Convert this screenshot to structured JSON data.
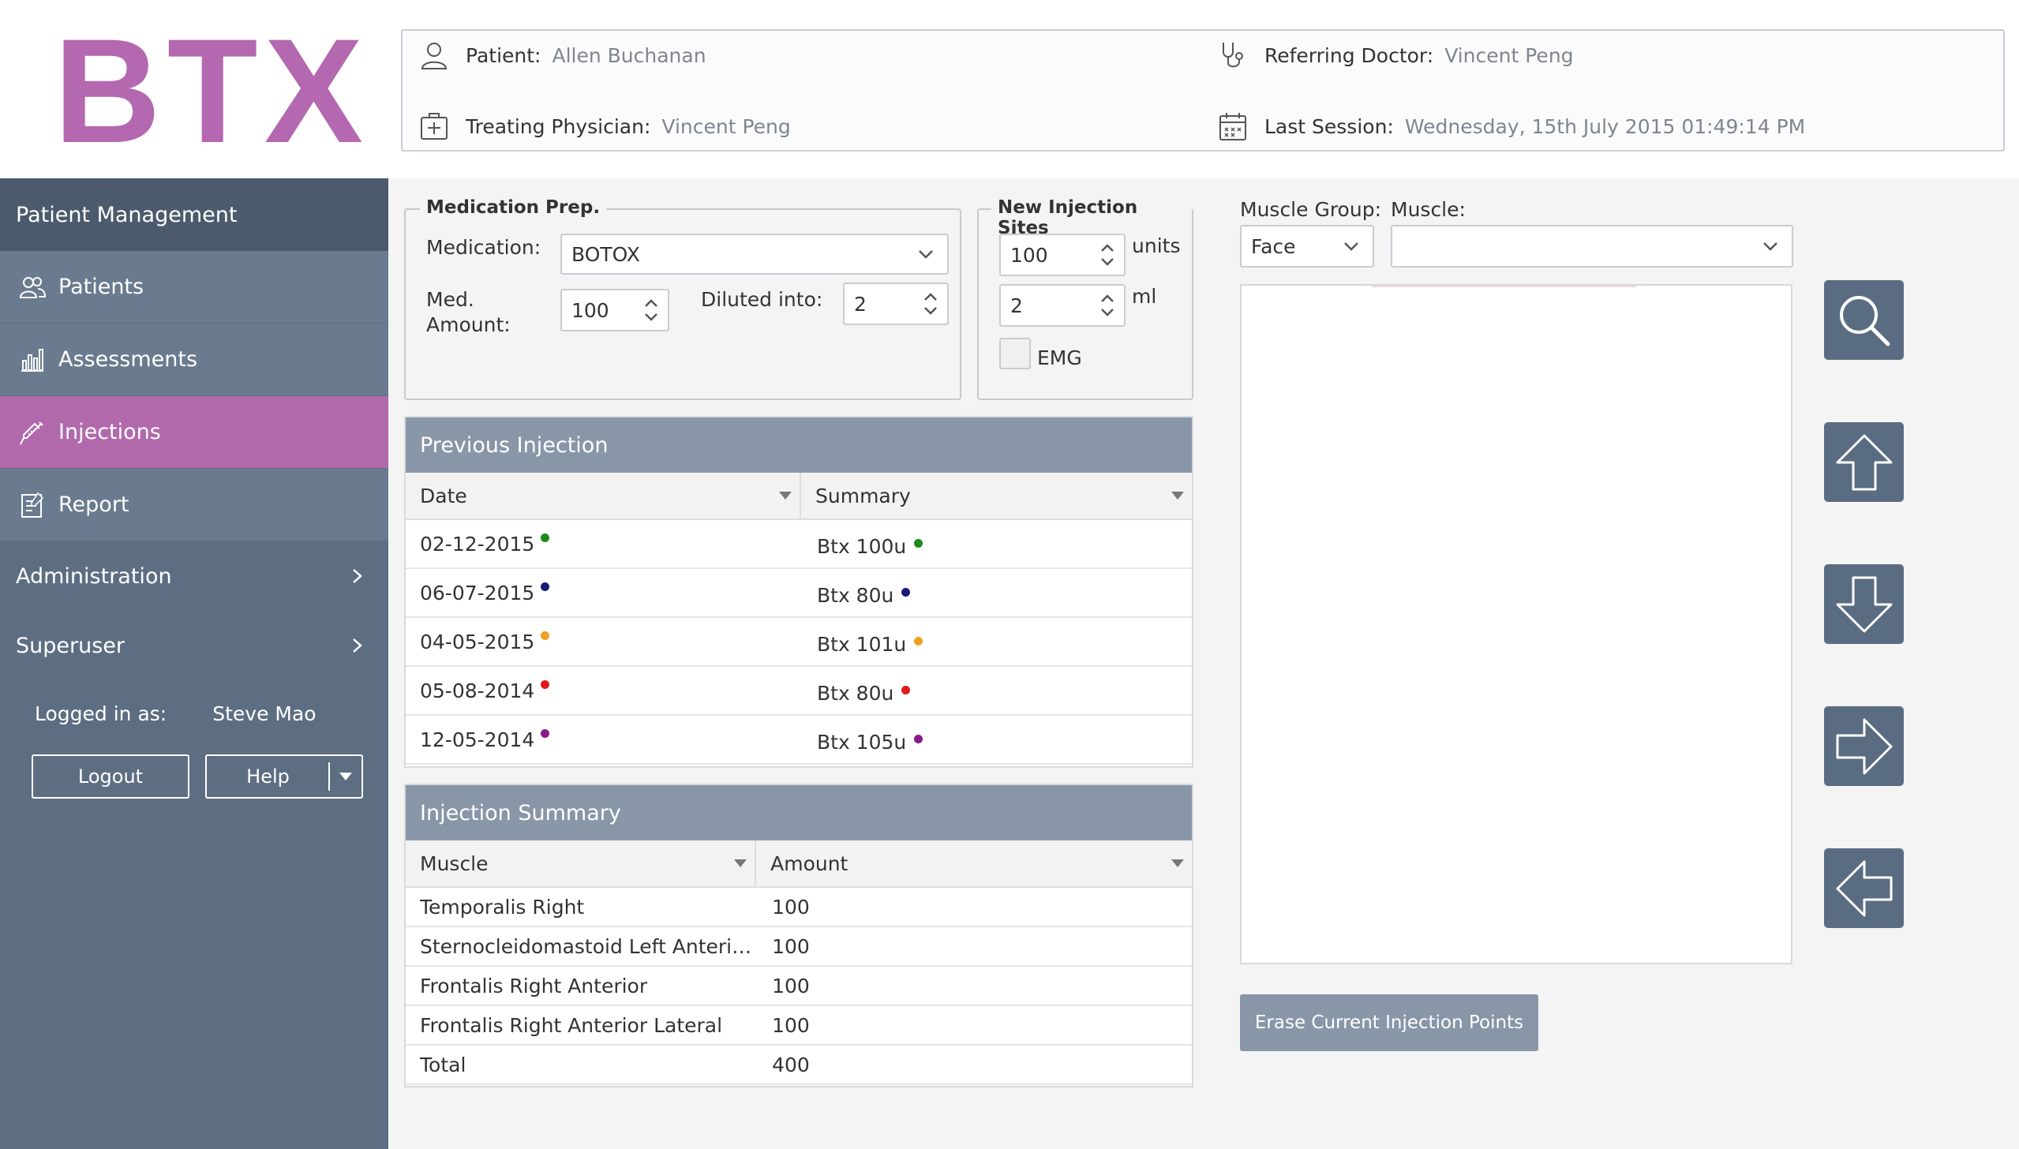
{
  "logo": "BTX",
  "header": {
    "patient_label": "Patient:",
    "patient_value": "Allen Buchanan",
    "referring_label": "Referring Doctor:",
    "referring_value": "Vincent Peng",
    "treating_label": "Treating Physician:",
    "treating_value": "Vincent Peng",
    "last_session_label": "Last Session:",
    "last_session_value": "Wednesday, 15th July 2015 01:49:14 PM"
  },
  "sidebar": {
    "section_title": "Patient Management",
    "items": [
      {
        "label": "Patients",
        "icon": "users-icon"
      },
      {
        "label": "Assessments",
        "icon": "bar-chart-icon"
      },
      {
        "label": "Injections",
        "icon": "syringe-icon",
        "active": true
      },
      {
        "label": "Report",
        "icon": "report-icon"
      }
    ],
    "administration": "Administration",
    "superuser": "Superuser",
    "logged_in_label": "Logged in as:",
    "logged_in_user": "Steve Mao",
    "logout_label": "Logout",
    "help_label": "Help"
  },
  "medication_prep": {
    "legend": "Medication Prep.",
    "medication_label": "Medication:",
    "medication_value": "BOTOX",
    "med_amount_label_1": "Med.",
    "med_amount_label_2": "Amount:",
    "med_amount_value": "100",
    "diluted_label": "Diluted into:",
    "diluted_value": "2"
  },
  "new_injection_sites": {
    "legend": "New Injection Sites",
    "units_value": "100",
    "units_label": "units",
    "ml_value": "2",
    "ml_label": "ml",
    "emg_label": "EMG",
    "emg_checked": false
  },
  "muscle_select": {
    "group_label": "Muscle Group:",
    "group_value": "Face",
    "muscle_label": "Muscle:",
    "muscle_value": ""
  },
  "previous_injection": {
    "title": "Previous Injection",
    "columns": [
      "Date",
      "Summary"
    ],
    "rows": [
      {
        "date": "02-12-2015",
        "summary": "Btx 100u",
        "color": "#1a8a1a"
      },
      {
        "date": "06-07-2015",
        "summary": "Btx 80u",
        "color": "#1a1a7a"
      },
      {
        "date": "04-05-2015",
        "summary": "Btx 101u",
        "color": "#f0a020"
      },
      {
        "date": "05-08-2014",
        "summary": "Btx 80u",
        "color": "#e01a1a"
      },
      {
        "date": "12-05-2014",
        "summary": "Btx 105u",
        "color": "#8a1a8a"
      }
    ]
  },
  "injection_summary": {
    "title": "Injection Summary",
    "columns": [
      "Muscle",
      "Amount"
    ],
    "rows": [
      {
        "muscle": "Temporalis Right",
        "amount": "100"
      },
      {
        "muscle": "Sternocleidomastoid Left Anteri…",
        "amount": "100"
      },
      {
        "muscle": "Frontalis Right Anterior",
        "amount": "100"
      },
      {
        "muscle": "Frontalis Right Anterior Lateral",
        "amount": "100"
      },
      {
        "muscle": "Total",
        "amount": "400"
      }
    ]
  },
  "erase_button": "Erase Current Injection Points",
  "nav_buttons": [
    "zoom-icon",
    "arrow-up-icon",
    "arrow-down-icon",
    "arrow-right-icon",
    "arrow-left-icon"
  ],
  "colors": {
    "brand": "#b468b0",
    "sidebar": "#5d6e83",
    "active": "#b169ac",
    "panel_header": "#8896a8",
    "nav_button": "#5a6c81"
  }
}
